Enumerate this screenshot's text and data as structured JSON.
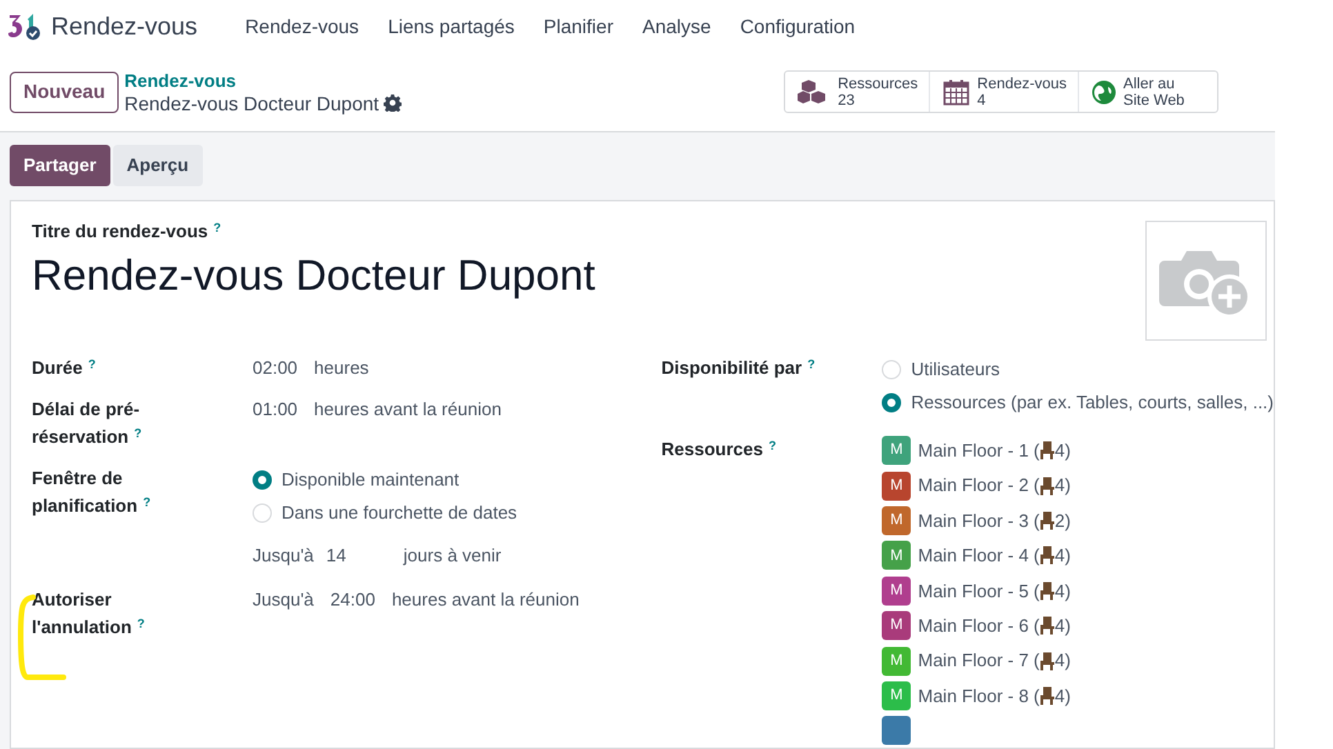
{
  "app": {
    "name": "Rendez-vous"
  },
  "menu": [
    {
      "label": "Rendez-vous"
    },
    {
      "label": "Liens partagés"
    },
    {
      "label": "Planifier"
    },
    {
      "label": "Analyse"
    },
    {
      "label": "Configuration"
    }
  ],
  "control_panel": {
    "new_button": "Nouveau",
    "breadcrumb": "Rendez-vous",
    "record": "Rendez-vous Docteur Dupont",
    "smart_buttons": [
      {
        "kind": "resources",
        "label": "Ressources",
        "value": "23"
      },
      {
        "kind": "calendar",
        "label": "Rendez-vous",
        "value": "4"
      },
      {
        "kind": "globe",
        "label": "Aller au",
        "value": "Site Web"
      }
    ]
  },
  "tabs": [
    {
      "label": "Partager",
      "selected": true
    },
    {
      "label": "Aperçu",
      "selected": false
    }
  ],
  "form": {
    "title_label": "Titre du rendez-vous",
    "help": "?",
    "title": "Rendez-vous Docteur Dupont",
    "left": [
      {
        "kind": "value",
        "label": "Durée",
        "parts": [
          "02:00",
          "heures"
        ]
      },
      {
        "kind": "value",
        "label": "Délai de pré-réservation",
        "parts": [
          "01:00",
          "heures avant la réunion"
        ]
      },
      {
        "kind": "radio",
        "label": "Fenêtre de planification",
        "options": [
          {
            "label": "Disponible maintenant",
            "selected": true
          },
          {
            "label": "Dans une fourchette de dates",
            "selected": false
          }
        ],
        "extra": [
          "Jusqu'à",
          "14",
          "jours à venir"
        ]
      },
      {
        "kind": "value",
        "label": "Autoriser l'annulation",
        "parts": [
          "Jusqu'à",
          "24:00",
          "heures avant la réunion"
        ]
      }
    ],
    "availability": {
      "label": "Disponibilité par",
      "options": [
        {
          "label": "Utilisateurs",
          "selected": false
        },
        {
          "label": "Ressources (par ex. Tables, courts, salles, ...)",
          "selected": true
        }
      ]
    },
    "resources": {
      "label": "Ressources",
      "items": [
        {
          "letter": "M",
          "color": "#3fa37c",
          "name": "Main Floor - 1 (",
          "count": "4)"
        },
        {
          "letter": "M",
          "color": "#b8452e",
          "name": "Main Floor - 2 (",
          "count": "4)"
        },
        {
          "letter": "M",
          "color": "#c0682c",
          "name": "Main Floor - 3 (",
          "count": "2)"
        },
        {
          "letter": "M",
          "color": "#45a149",
          "name": "Main Floor - 4 (",
          "count": "4)"
        },
        {
          "letter": "M",
          "color": "#b03e8e",
          "name": "Main Floor - 5 (",
          "count": "4)"
        },
        {
          "letter": "M",
          "color": "#a93b7b",
          "name": "Main Floor - 6 (",
          "count": "4)"
        },
        {
          "letter": "M",
          "color": "#42b934",
          "name": "Main Floor - 7 (",
          "count": "4)"
        },
        {
          "letter": "M",
          "color": "#2cbd4a",
          "name": "Main Floor - 8 (",
          "count": "4)"
        },
        {
          "color": "#3b7aa8"
        }
      ]
    }
  }
}
